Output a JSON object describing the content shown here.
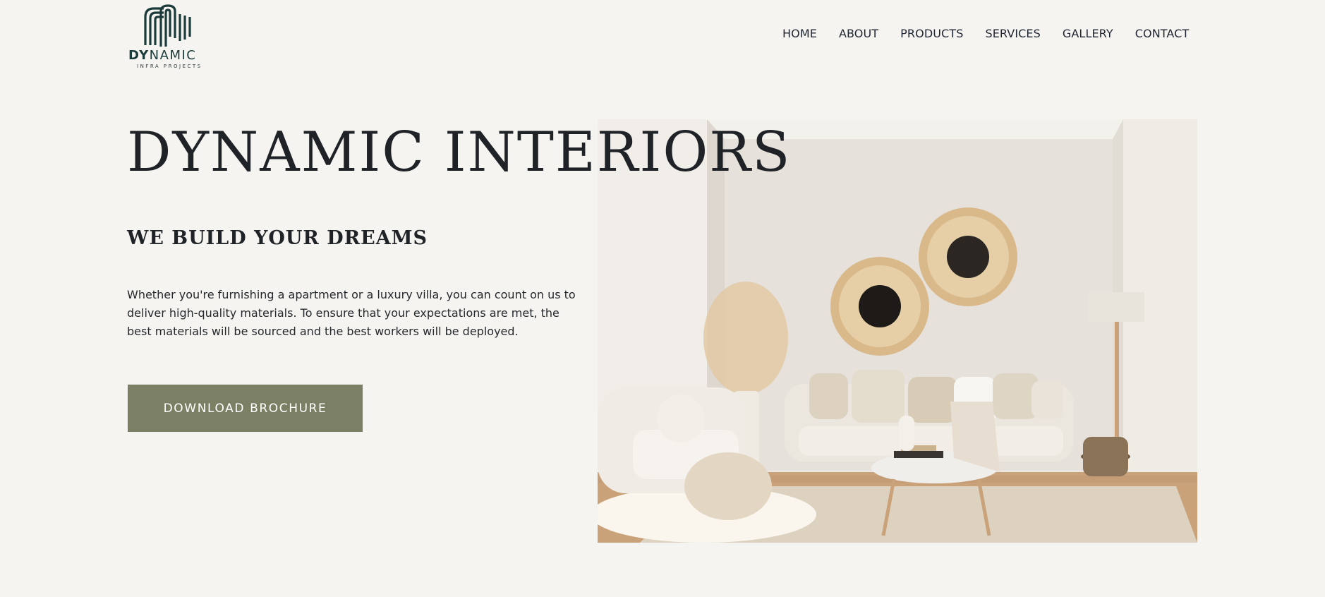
{
  "logo": {
    "word_strong": "DY",
    "word_rest": "NAMIC",
    "tagline": "INFRA PROJECTS",
    "icon": "striped-building-icon",
    "color": "#1b3b3a"
  },
  "nav": {
    "items": [
      "HOME",
      "ABOUT",
      "PRODUCTS",
      "SERVICES",
      "GALLERY",
      "CONTACT"
    ]
  },
  "hero": {
    "title": "DYNAMIC INTERIORS",
    "subtitle": "WE BUILD YOUR DREAMS",
    "description": "Whether you're furnishing a apartment or a luxury villa, you can count on us to deliver high-quality materials. To ensure that your expectations are met, the best materials will be sourced and the best workers will be deployed.",
    "cta_label": "DOWNLOAD BROCHURE",
    "image_icon": "living-room-photo"
  },
  "colors": {
    "background": "#f5f4f0",
    "cta": "#7b8064",
    "text": "#1f2226"
  }
}
